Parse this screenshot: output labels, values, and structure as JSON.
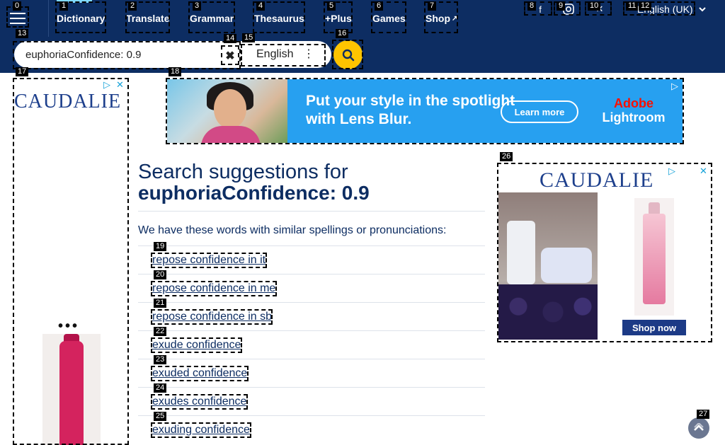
{
  "nav": {
    "items": [
      {
        "label": "Dictionary"
      },
      {
        "label": "Translate"
      },
      {
        "label": "Grammar"
      },
      {
        "label": "Thesaurus"
      },
      {
        "label": "+Plus"
      },
      {
        "label": "Games"
      },
      {
        "label": "Shop"
      }
    ],
    "language": "English (UK)"
  },
  "search": {
    "value": "euphoriaConfidence: 0.9",
    "dictionary": "English"
  },
  "banner": {
    "headline": "Put your style in the spotlight with Lens Blur.",
    "cta": "Learn more",
    "logo_line1": "Adobe",
    "logo_line2": "Lightroom"
  },
  "ads": {
    "brand": "CAUDALIE",
    "shop_now": "Shop now"
  },
  "main": {
    "heading_prefix": "Search suggestions for",
    "heading_term": "euphoriaConfidence: 0.9",
    "subtitle": "We have these words with similar spellings or pronunciations:",
    "suggestions": [
      "repose confidence in it",
      "repose confidence in me",
      "repose confidence in sb",
      "exude confidence",
      "exuded confidence",
      "exudes confidence",
      "exuding confidence"
    ]
  },
  "markers": [
    "0",
    "1",
    "2",
    "3",
    "4",
    "5",
    "6",
    "7",
    "8",
    "9",
    "10",
    "11",
    "12",
    "13",
    "14",
    "15",
    "16",
    "17",
    "18",
    "19",
    "20",
    "21",
    "22",
    "23",
    "24",
    "25",
    "26",
    "27"
  ]
}
